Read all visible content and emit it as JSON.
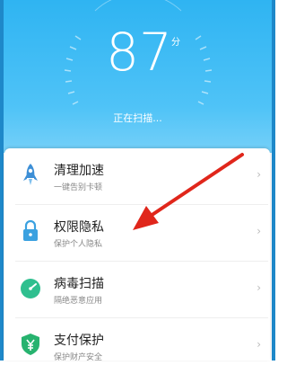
{
  "header": {
    "score": "87",
    "score_unit": "分",
    "status": "正在扫描..."
  },
  "items": [
    {
      "title": "清理加速",
      "subtitle": "一键告别卡顿",
      "icon": "rocket-icon"
    },
    {
      "title": "权限隐私",
      "subtitle": "保护个人隐私",
      "icon": "lock-icon"
    },
    {
      "title": "病毒扫描",
      "subtitle": "隔绝恶意应用",
      "icon": "gauge-icon"
    },
    {
      "title": "支付保护",
      "subtitle": "保护财产安全",
      "icon": "shield-yuan-icon"
    }
  ],
  "chevron": "›",
  "colors": {
    "header_blue": "#2fb4f2",
    "rocket_blue": "#3d8fd6",
    "lock_blue": "#3ba1e0",
    "gauge_green": "#2fbf8f",
    "shield_green": "#27b36f",
    "annotation_red": "#e0261b"
  }
}
